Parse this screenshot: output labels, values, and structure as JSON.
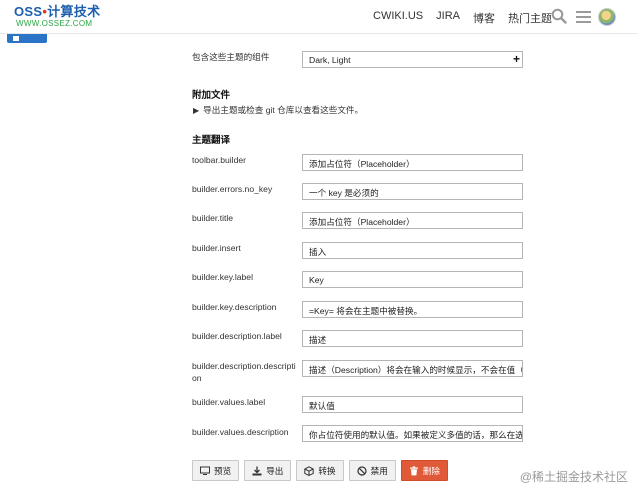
{
  "header": {
    "logo_main_a": "OSS",
    "logo_dot": "•",
    "logo_main_b": "计算技术",
    "logo_sub": "WWW.OSSEZ.COM",
    "nav": [
      "CWIKI.US",
      "JIRA",
      "博客",
      "热门主题"
    ]
  },
  "components": {
    "label": "包含这些主题的组件",
    "value": "Dark, Light",
    "add": "+"
  },
  "attachments": {
    "title": "附加文件",
    "arrow": "▶",
    "text": "导出主题或检查 git 仓库以查看这些文件。"
  },
  "translations": {
    "title": "主题翻译",
    "rows": [
      {
        "label": "toolbar.builder",
        "value": "添加占位符（Placeholder）"
      },
      {
        "label": "builder.errors.no_key",
        "value": "一个 key 是必须的"
      },
      {
        "label": "builder.title",
        "value": "添加占位符（Placeholder）"
      },
      {
        "label": "builder.insert",
        "value": "插入"
      },
      {
        "label": "builder.key.label",
        "value": "Key"
      },
      {
        "label": "builder.key.description",
        "value": "=Key= 将会在主题中被替换。"
      },
      {
        "label": "builder.description.label",
        "value": "描述"
      },
      {
        "label": "builder.description.descripti",
        "label2": "on",
        "value": "描述（Description）将会在输入的时候显示，不会在值（V"
      },
      {
        "label": "builder.values.label",
        "value": "默认值"
      },
      {
        "label": "builder.values.description",
        "value": "你占位符使用的默认值。如果被定义多值的话，那么在选择"
      }
    ]
  },
  "buttons": {
    "preview": "预览",
    "export": "导出",
    "convert": "转换",
    "disable": "禁用",
    "delete": "删除"
  },
  "watermark": "@稀土掘金技术社区"
}
